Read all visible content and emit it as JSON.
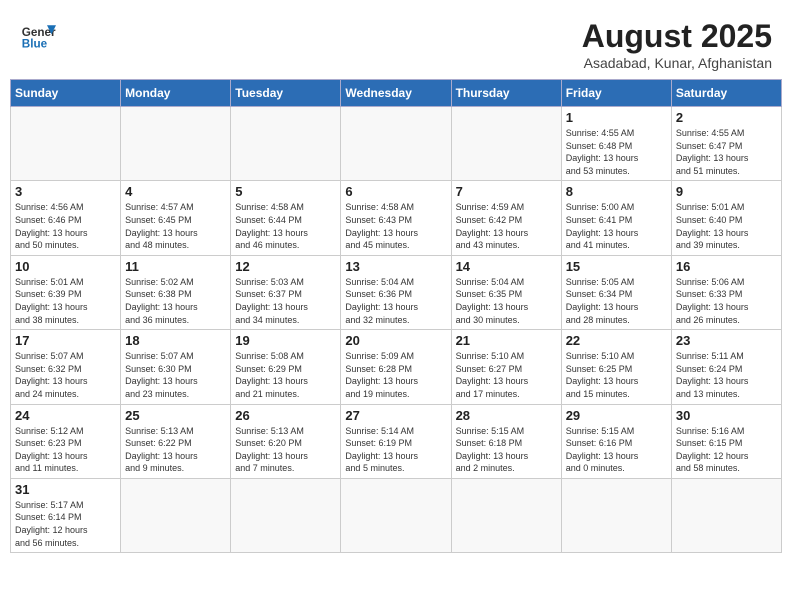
{
  "header": {
    "logo_line1": "General",
    "logo_line2": "Blue",
    "title": "August 2025",
    "subtitle": "Asadabad, Kunar, Afghanistan"
  },
  "weekdays": [
    "Sunday",
    "Monday",
    "Tuesday",
    "Wednesday",
    "Thursday",
    "Friday",
    "Saturday"
  ],
  "weeks": [
    [
      {
        "day": "",
        "info": ""
      },
      {
        "day": "",
        "info": ""
      },
      {
        "day": "",
        "info": ""
      },
      {
        "day": "",
        "info": ""
      },
      {
        "day": "",
        "info": ""
      },
      {
        "day": "1",
        "info": "Sunrise: 4:55 AM\nSunset: 6:48 PM\nDaylight: 13 hours\nand 53 minutes."
      },
      {
        "day": "2",
        "info": "Sunrise: 4:55 AM\nSunset: 6:47 PM\nDaylight: 13 hours\nand 51 minutes."
      }
    ],
    [
      {
        "day": "3",
        "info": "Sunrise: 4:56 AM\nSunset: 6:46 PM\nDaylight: 13 hours\nand 50 minutes."
      },
      {
        "day": "4",
        "info": "Sunrise: 4:57 AM\nSunset: 6:45 PM\nDaylight: 13 hours\nand 48 minutes."
      },
      {
        "day": "5",
        "info": "Sunrise: 4:58 AM\nSunset: 6:44 PM\nDaylight: 13 hours\nand 46 minutes."
      },
      {
        "day": "6",
        "info": "Sunrise: 4:58 AM\nSunset: 6:43 PM\nDaylight: 13 hours\nand 45 minutes."
      },
      {
        "day": "7",
        "info": "Sunrise: 4:59 AM\nSunset: 6:42 PM\nDaylight: 13 hours\nand 43 minutes."
      },
      {
        "day": "8",
        "info": "Sunrise: 5:00 AM\nSunset: 6:41 PM\nDaylight: 13 hours\nand 41 minutes."
      },
      {
        "day": "9",
        "info": "Sunrise: 5:01 AM\nSunset: 6:40 PM\nDaylight: 13 hours\nand 39 minutes."
      }
    ],
    [
      {
        "day": "10",
        "info": "Sunrise: 5:01 AM\nSunset: 6:39 PM\nDaylight: 13 hours\nand 38 minutes."
      },
      {
        "day": "11",
        "info": "Sunrise: 5:02 AM\nSunset: 6:38 PM\nDaylight: 13 hours\nand 36 minutes."
      },
      {
        "day": "12",
        "info": "Sunrise: 5:03 AM\nSunset: 6:37 PM\nDaylight: 13 hours\nand 34 minutes."
      },
      {
        "day": "13",
        "info": "Sunrise: 5:04 AM\nSunset: 6:36 PM\nDaylight: 13 hours\nand 32 minutes."
      },
      {
        "day": "14",
        "info": "Sunrise: 5:04 AM\nSunset: 6:35 PM\nDaylight: 13 hours\nand 30 minutes."
      },
      {
        "day": "15",
        "info": "Sunrise: 5:05 AM\nSunset: 6:34 PM\nDaylight: 13 hours\nand 28 minutes."
      },
      {
        "day": "16",
        "info": "Sunrise: 5:06 AM\nSunset: 6:33 PM\nDaylight: 13 hours\nand 26 minutes."
      }
    ],
    [
      {
        "day": "17",
        "info": "Sunrise: 5:07 AM\nSunset: 6:32 PM\nDaylight: 13 hours\nand 24 minutes."
      },
      {
        "day": "18",
        "info": "Sunrise: 5:07 AM\nSunset: 6:30 PM\nDaylight: 13 hours\nand 23 minutes."
      },
      {
        "day": "19",
        "info": "Sunrise: 5:08 AM\nSunset: 6:29 PM\nDaylight: 13 hours\nand 21 minutes."
      },
      {
        "day": "20",
        "info": "Sunrise: 5:09 AM\nSunset: 6:28 PM\nDaylight: 13 hours\nand 19 minutes."
      },
      {
        "day": "21",
        "info": "Sunrise: 5:10 AM\nSunset: 6:27 PM\nDaylight: 13 hours\nand 17 minutes."
      },
      {
        "day": "22",
        "info": "Sunrise: 5:10 AM\nSunset: 6:25 PM\nDaylight: 13 hours\nand 15 minutes."
      },
      {
        "day": "23",
        "info": "Sunrise: 5:11 AM\nSunset: 6:24 PM\nDaylight: 13 hours\nand 13 minutes."
      }
    ],
    [
      {
        "day": "24",
        "info": "Sunrise: 5:12 AM\nSunset: 6:23 PM\nDaylight: 13 hours\nand 11 minutes."
      },
      {
        "day": "25",
        "info": "Sunrise: 5:13 AM\nSunset: 6:22 PM\nDaylight: 13 hours\nand 9 minutes."
      },
      {
        "day": "26",
        "info": "Sunrise: 5:13 AM\nSunset: 6:20 PM\nDaylight: 13 hours\nand 7 minutes."
      },
      {
        "day": "27",
        "info": "Sunrise: 5:14 AM\nSunset: 6:19 PM\nDaylight: 13 hours\nand 5 minutes."
      },
      {
        "day": "28",
        "info": "Sunrise: 5:15 AM\nSunset: 6:18 PM\nDaylight: 13 hours\nand 2 minutes."
      },
      {
        "day": "29",
        "info": "Sunrise: 5:15 AM\nSunset: 6:16 PM\nDaylight: 13 hours\nand 0 minutes."
      },
      {
        "day": "30",
        "info": "Sunrise: 5:16 AM\nSunset: 6:15 PM\nDaylight: 12 hours\nand 58 minutes."
      }
    ],
    [
      {
        "day": "31",
        "info": "Sunrise: 5:17 AM\nSunset: 6:14 PM\nDaylight: 12 hours\nand 56 minutes."
      },
      {
        "day": "",
        "info": ""
      },
      {
        "day": "",
        "info": ""
      },
      {
        "day": "",
        "info": ""
      },
      {
        "day": "",
        "info": ""
      },
      {
        "day": "",
        "info": ""
      },
      {
        "day": "",
        "info": ""
      }
    ]
  ]
}
